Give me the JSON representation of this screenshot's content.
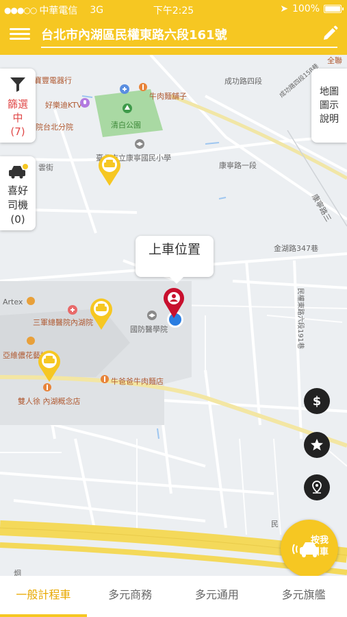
{
  "status_bar": {
    "carrier": "中華電信",
    "network": "3G",
    "time": "下午2:25",
    "battery": "100%"
  },
  "header": {
    "address": "台北市內湖區民權東路六段161號"
  },
  "side": {
    "filter_line1": "篩選",
    "filter_line2": "中",
    "filter_count": "(7)",
    "fav_line1": "喜好",
    "fav_line2": "司機",
    "fav_count": "(0)",
    "legend_line1": "地圖",
    "legend_line2": "圖示",
    "legend_line3": "說明"
  },
  "pickup": {
    "label": "上車位置"
  },
  "map_labels": {
    "store": "寶豐電器行",
    "ktv": "好樂迪KTV",
    "hospital_branch": "院台北分院",
    "park": "清白公園",
    "school": "臺北市立康寧國民小學",
    "beef_noodle": "牛肉麵舖子",
    "road_chenggong": "成功路四段",
    "road_kangning1": "康寧路一段",
    "road_kangning3": "康寧路三",
    "lane_158": "成功路四段158巷",
    "road_jinhu": "金湖路347巷",
    "road_minquan": "民權東路六段191巷",
    "artex": "Artex",
    "tri_hospital": "三軍總醫院內湖院",
    "defense_college": "國防醫學院",
    "florist": "亞維儂花藝設計",
    "niu_ba_ba": "牛爸爸牛肉麵店",
    "xu_neihu": "雙人徐 內湖概念店",
    "quanlian": "全聯",
    "partial_yunshe": "雲街",
    "partial_min": "民",
    "partial_jiu": "炯"
  },
  "call_button": {
    "line1": "按我",
    "line2": "叫車"
  },
  "tabs": [
    {
      "label": "一般計程車"
    },
    {
      "label": "多元商務"
    },
    {
      "label": "多元通用"
    },
    {
      "label": "多元旗艦"
    }
  ],
  "colors": {
    "brand_yellow": "#f6c722",
    "pin_red": "#c8102e",
    "park_green": "#a9d9a3",
    "location_blue": "#2a7de1",
    "filter_red": "#e04848"
  },
  "icons": {
    "menu": "hamburger-icon",
    "edit": "pencil-icon",
    "filter": "funnel-icon",
    "favorite_driver": "taxi-star-icon",
    "price": "dollar-icon",
    "favorite": "star-icon",
    "locate": "location-pin-icon",
    "call": "taxi-signal-icon"
  }
}
